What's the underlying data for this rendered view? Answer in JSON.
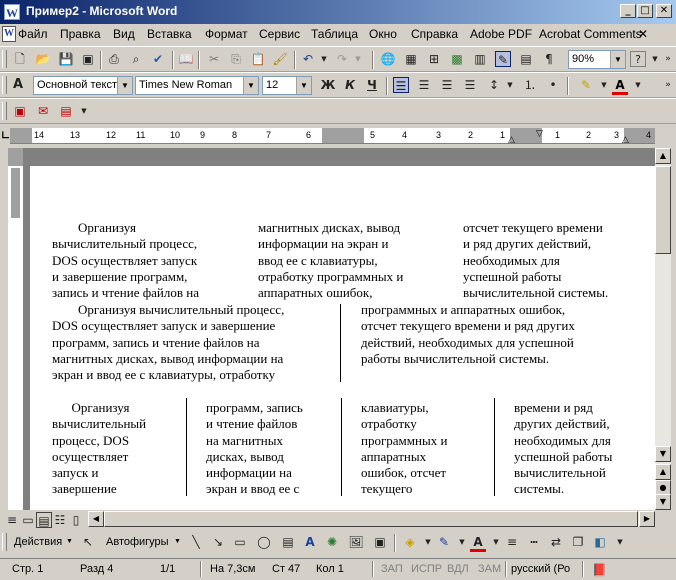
{
  "window": {
    "title": "Пример2 - Microsoft Word",
    "app_icon": "W"
  },
  "menu": [
    "Файл",
    "Правка",
    "Вид",
    "Вставка",
    "Формат",
    "Сервис",
    "Таблица",
    "Окно",
    "Справка",
    "Adobe PDF",
    "Acrobat Comments"
  ],
  "toolbar": {
    "zoom": "90%",
    "help": "?"
  },
  "format": {
    "style": "Основной текст",
    "font": "Times New Roman",
    "size": "12",
    "bold": "Ж",
    "italic": "К",
    "underline": "Ч"
  },
  "ruler": {
    "labels": [
      "14",
      "13",
      "12",
      "11",
      "10",
      "9",
      "8",
      "7",
      "6",
      "5",
      "4",
      "3",
      "2",
      "1",
      "1",
      "2",
      "3",
      "4"
    ]
  },
  "document": {
    "section1": {
      "col1": "        Организуя\nвычислительный процесс,\nDOS осуществляет запуск\nи завершение программ,\nзапись и чтение файлов на",
      "col2": "магнитных дисках, вывод\nинформации на экран и\nввод ее с клавиатуры,\nотработку программных и\nаппаратных ошибок,",
      "col3": "отсчет текущего времени\nи ряд других действий,\nнеобходимых для\nуспешной работы\nвычислительной системы."
    },
    "section2": {
      "col1": "        Организуя вычислительный процесс,\nDOS осуществляет запуск и завершение\nпрограмм, запись и чтение файлов на\nмагнитных дисках, вывод информации на\nэкран и ввод ее с клавиатуры, отработку",
      "col2": "программных и аппаратных ошибок,\nотсчет текущего времени и ряд других\nдействий, необходимых для успешной\nработы вычислительной системы."
    },
    "section3": {
      "col1": "      Организуя\nвычислительный\nпроцесс, DOS\nосуществляет\nзапуск и\nзавершение",
      "col2": "программ, запись\nи чтение файлов\nна магнитных\nдисках, вывод\nинформации на\nэкран и ввод ее с",
      "col3": "клавиатуры,\nотработку\nпрограммных и\nаппаратных\nошибок, отсчет\nтекущего",
      "col4": "времени и ряд\nдругих действий,\nнеобходимых для\nуспешной работы\nвычислительной\nсистемы."
    }
  },
  "drawing": {
    "actions": "Действия",
    "autoshapes": "Автофигуры"
  },
  "status": {
    "page": "Стр. 1",
    "section": "Разд 4",
    "pages": "1/1",
    "at": "На 7,3см",
    "line": "Ст 47",
    "col": "Кол 1",
    "rec": "ЗАП",
    "trk": "ИСПР",
    "ext": "ВДЛ",
    "ovr": "ЗАМ",
    "lang": "русский (Ро"
  }
}
